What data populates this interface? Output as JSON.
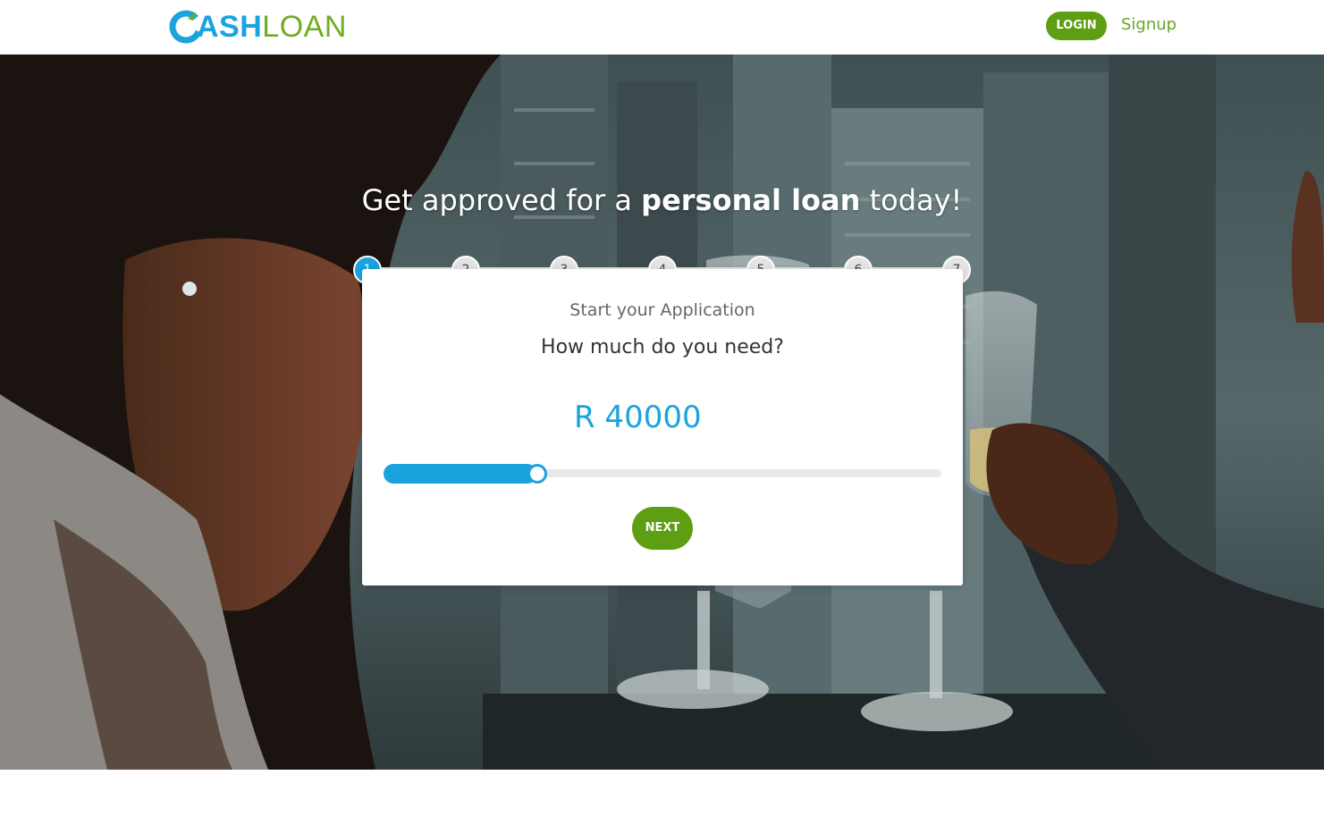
{
  "brand": {
    "name_part1": "ASH",
    "name_part2": "LOAN",
    "primary_color": "#1ba3de",
    "accent_color": "#72ac24"
  },
  "header": {
    "login_label": "LOGIN",
    "signup_label": "Signup"
  },
  "hero": {
    "headline_pre": "Get approved for a ",
    "headline_bold": "personal loan",
    "headline_post": " today!"
  },
  "stepper": {
    "steps": [
      "1",
      "2",
      "3",
      "4",
      "5",
      "6",
      "7"
    ],
    "active_step": 1
  },
  "card": {
    "subtitle": "Start your Application",
    "question": "How much do you need?",
    "amount": "R 40000",
    "slider_fraction": 0.275,
    "next_label": "NEXT"
  }
}
